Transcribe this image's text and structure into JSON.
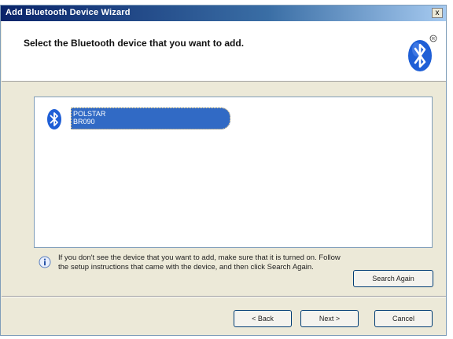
{
  "window": {
    "title": "Add Bluetooth Device Wizard",
    "close_label": "x"
  },
  "header": {
    "title": "Select the Bluetooth device that you want to add."
  },
  "devices": [
    {
      "name": "POLSTAR",
      "address": "BR090",
      "selected": true,
      "icon": "bluetooth-icon"
    }
  ],
  "info": {
    "text": "If you don't see the device that you want to add, make sure that it is turned on. Follow the setup instructions that came with the device, and then click Search Again.",
    "icon": "info-icon"
  },
  "buttons": {
    "search_again": "Search Again",
    "back": "< Back",
    "next": "Next >",
    "cancel": "Cancel"
  },
  "colors": {
    "titlebar": "#0a246a",
    "selection": "#316ac5",
    "bluetooth_blue": "#1f5fd6",
    "dialog_bg": "#ece9d8"
  }
}
